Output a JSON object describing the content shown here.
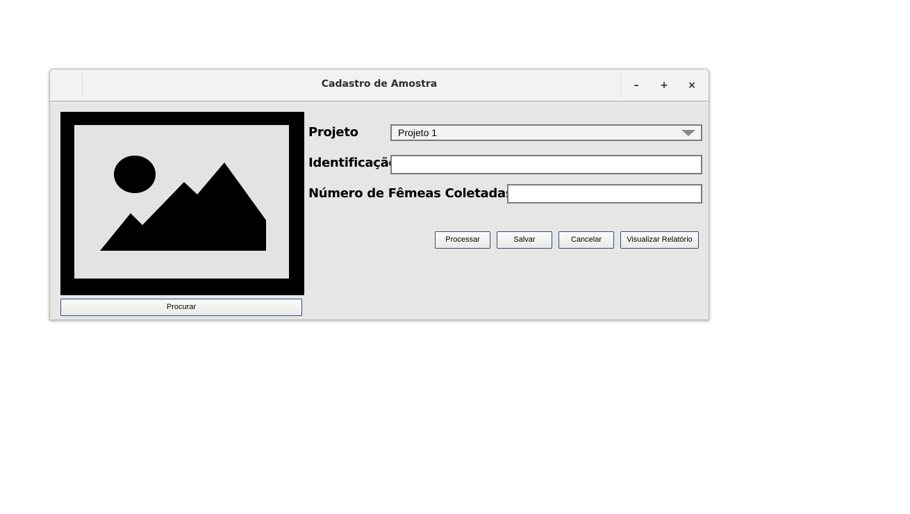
{
  "window": {
    "title": "Cadastro de Amostra",
    "controls": {
      "minimize": "–",
      "maximize": "+",
      "close": "×"
    }
  },
  "image": {
    "icon": "image-placeholder-icon"
  },
  "buttons": {
    "browse": "Procurar",
    "process": "Processar",
    "save": "Salvar",
    "cancel": "Cancelar",
    "report": "Visualizar Relatório"
  },
  "form": {
    "project_label": "Projeto",
    "project_value": "Projeto 1",
    "identification_label": "Identificação",
    "identification_value": "",
    "females_label": "Número de Fêmeas Coletadas",
    "females_value": ""
  },
  "colors": {
    "window_bg": "#e6e6e5",
    "titlebar_bg": "#f2f2f2",
    "button_border": "#2f4d7c"
  }
}
